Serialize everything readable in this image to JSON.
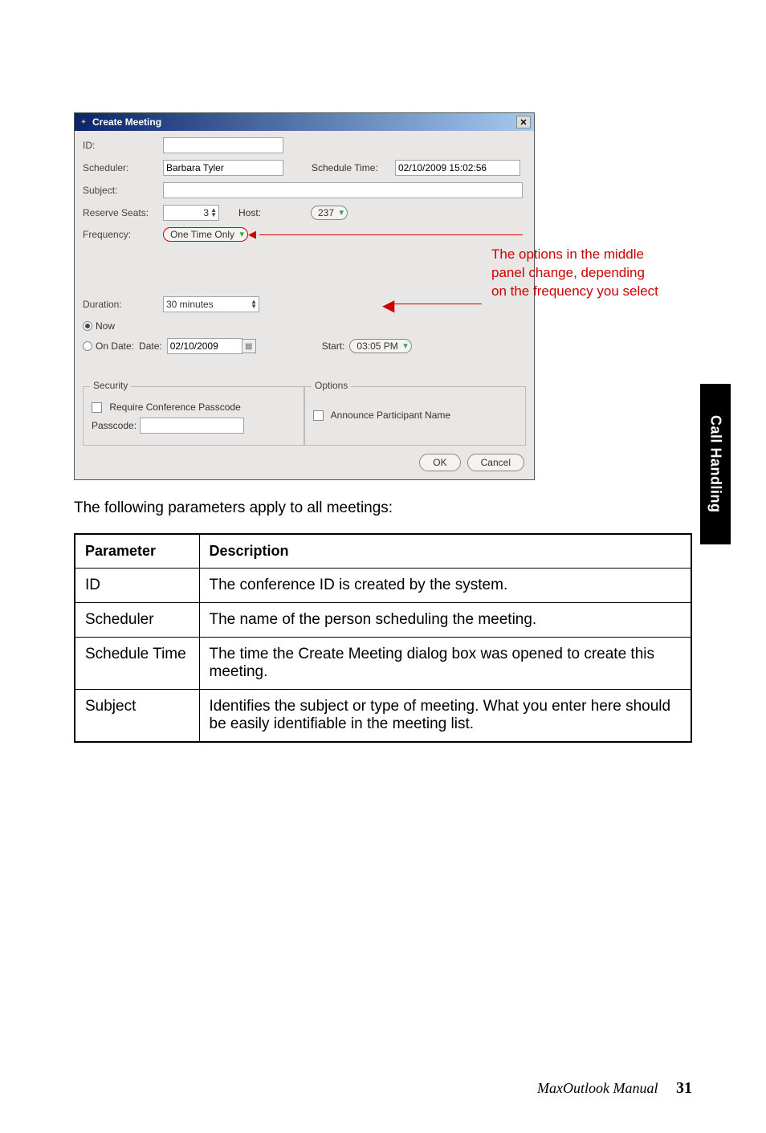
{
  "dialog": {
    "title": "Create Meeting",
    "labels": {
      "id": "ID:",
      "scheduler": "Scheduler:",
      "schedule_time": "Schedule Time:",
      "subject": "Subject:",
      "reserve_seats": "Reserve Seats:",
      "host": "Host:",
      "frequency": "Frequency:",
      "duration": "Duration:",
      "now": "Now",
      "on_date": "On Date:",
      "date": "Date:",
      "start": "Start:",
      "security_legend": "Security",
      "options_legend": "Options",
      "require_passcode": "Require Conference Passcode",
      "passcode": "Passcode:",
      "announce_name": "Announce Participant Name"
    },
    "values": {
      "id": "",
      "scheduler": "Barbara Tyler",
      "schedule_time": "02/10/2009 15:02:56",
      "subject": "",
      "reserve_seats": "3",
      "host": "237",
      "frequency": "One Time Only",
      "duration": "30 minutes",
      "date": "02/10/2009",
      "start": "03:05 PM",
      "passcode": ""
    },
    "buttons": {
      "ok": "OK",
      "cancel": "Cancel"
    }
  },
  "annotation": "The options in the middle panel change, depending on the frequency you select",
  "intro": "The following parameters apply to all meetings:",
  "table": {
    "headers": {
      "param": "Parameter",
      "desc": "Description"
    },
    "rows": [
      {
        "param": "ID",
        "desc": "The conference ID is created by the system."
      },
      {
        "param": "Scheduler",
        "desc": "The name of the person scheduling the meeting."
      },
      {
        "param": "Schedule Time",
        "desc": "The time the Create Meeting dialog box was opened to create this meeting."
      },
      {
        "param": "Subject",
        "desc": "Identifies the subject or type of meeting. What you enter here should be easily identifiable in the meeting list."
      }
    ]
  },
  "side_tab": "Call Handling",
  "footer": {
    "book": "MaxOutlook Manual",
    "page": "31"
  }
}
